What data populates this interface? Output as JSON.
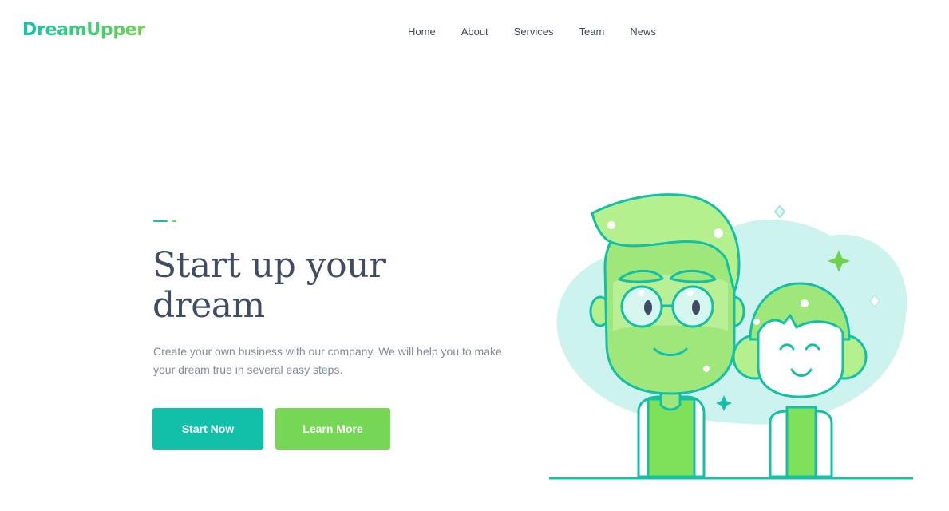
{
  "brand": {
    "name": "DreamUpper"
  },
  "nav": {
    "items": [
      {
        "label": "Home"
      },
      {
        "label": "About"
      },
      {
        "label": "Services"
      },
      {
        "label": "Team"
      },
      {
        "label": "News"
      }
    ]
  },
  "hero": {
    "headline": "Start up your dream",
    "subtext": "Create your own business with our company. We will help you to make your dream true in several easy steps.",
    "primary_button": "Start Now",
    "secondary_button": "Learn More"
  },
  "colors": {
    "teal": "#12bfa8",
    "green": "#76d756",
    "heading": "#3f4c63",
    "body_text": "#838b99",
    "illustration_bg": "#cdf3ee"
  }
}
